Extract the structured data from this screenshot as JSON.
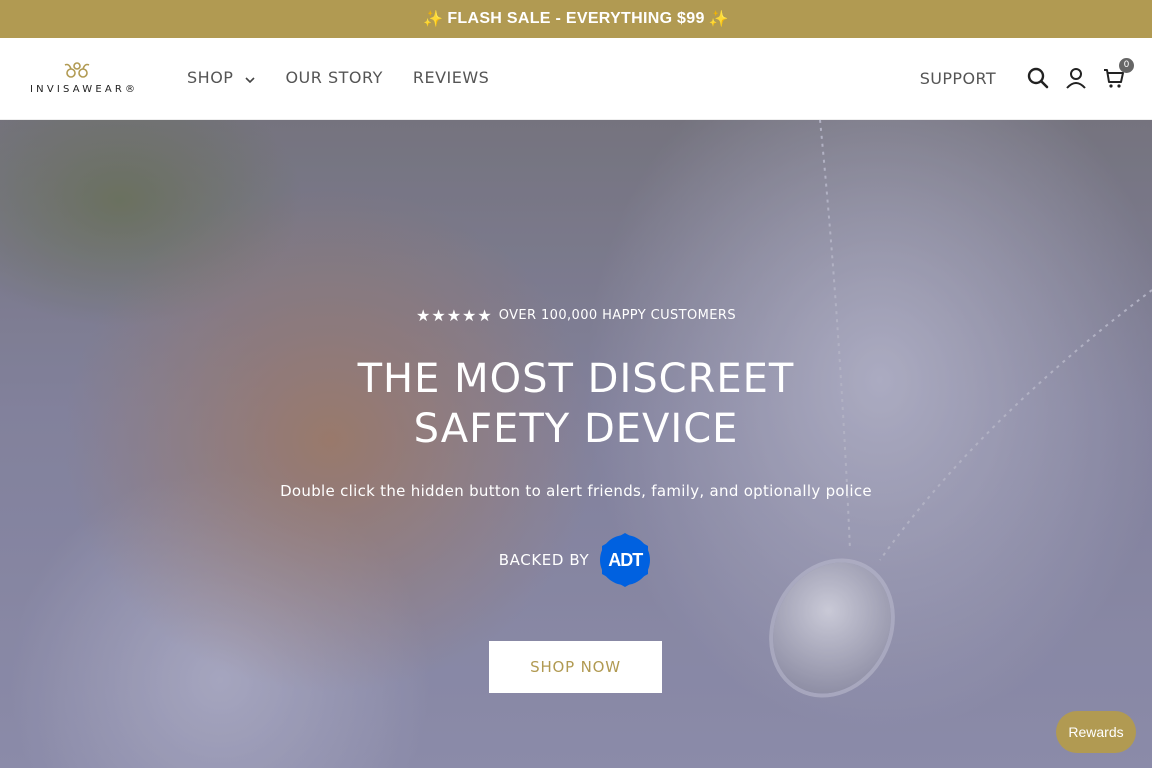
{
  "announcement": {
    "text": "FLASH SALE - EVERYTHING $99",
    "spark_icon": "✨"
  },
  "header": {
    "logo_text": "INVISAWEAR®",
    "nav": [
      {
        "label": "SHOP",
        "has_dropdown": true
      },
      {
        "label": "OUR STORY"
      },
      {
        "label": "REVIEWS"
      }
    ],
    "support_label": "SUPPORT",
    "icons": [
      "search-icon",
      "account-icon",
      "cart-icon"
    ],
    "cart_count": "0"
  },
  "hero": {
    "stars": "★★★★★",
    "rating_text": "OVER 100,000 HAPPY CUSTOMERS",
    "headline_line1": "THE MOST DISCREET",
    "headline_line2": "SAFETY DEVICE",
    "subline": "Double click the hidden button to alert friends, family, and optionally police",
    "backed_by": "BACKED BY",
    "adt_text": "ADT",
    "cta_label": "SHOP NOW"
  },
  "rewards_label": "Rewards",
  "colors": {
    "brand_gold": "#b19a52",
    "adt_blue": "#0061e0",
    "white": "#ffffff"
  }
}
